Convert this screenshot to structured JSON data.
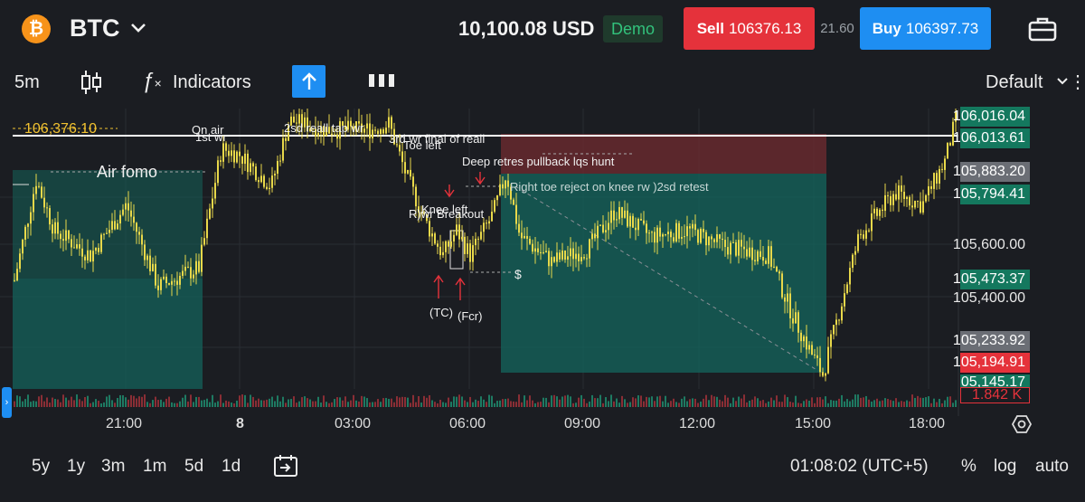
{
  "header": {
    "symbol": "BTC",
    "balance": "10,100.08 USD",
    "mode_badge": "Demo",
    "sell": {
      "label": "Sell",
      "price": "106376.13"
    },
    "spread": "21.60",
    "buy": {
      "label": "Buy",
      "price": "106397.73"
    }
  },
  "toolbar": {
    "interval": "5m",
    "indicators_label": "Indicators",
    "layout_label": "Default"
  },
  "chart": {
    "current_price_label": "106,376.10",
    "price_axis": {
      "ticks": [
        "106,016.04",
        "106,013.61",
        "105,883.20",
        "105,794.41",
        "105,600.00",
        "105,473.37",
        "105,400.00",
        "105,233.92",
        "105,194.91",
        "105,145.17"
      ],
      "volume_label": "1.842 K"
    },
    "time_axis": [
      "21:00",
      "8",
      "03:00",
      "06:00",
      "09:00",
      "12:00",
      "15:00",
      "18:00"
    ],
    "annotations": {
      "air_fomo": "Air fomo",
      "on_air": "On air",
      "first_wr": "1st wr",
      "second_sd": "2sd reall tap wr",
      "third_sd": "3rd wr final of reall",
      "toe_left": "Toe left",
      "deep_retres": "Deep retres pullback lqs hunt",
      "right_toe": "Right toe reject on knee rw )2sd retest",
      "knee_left": "Knee left",
      "r_breakout": "R)wr Breakout",
      "tc": "(TC)",
      "fcr": "(Fcr)",
      "dollar": "$"
    }
  },
  "bottom": {
    "ranges": [
      "5y",
      "1y",
      "3m",
      "1m",
      "5d",
      "1d"
    ],
    "clock": "01:08:02 (UTC+5)",
    "percent": "%",
    "log": "log",
    "auto": "auto"
  },
  "colors": {
    "sell": "#e5323b",
    "buy": "#1e8ef2",
    "candle": "#e8d84a",
    "zone_green": "#14625a",
    "zone_red": "#6b2a2f",
    "accent_price": "#f2c230"
  },
  "chart_data": {
    "type": "candlestick",
    "series_color": "#e8d84a",
    "ylim": [
      105145.17,
      106016.04
    ],
    "x": [
      "21:00",
      "03:00",
      "06:00",
      "09:00",
      "12:00",
      "15:00",
      "18:00"
    ],
    "values": [
      105560,
      105990,
      105720,
      105620,
      105660,
      105180,
      105960
    ]
  }
}
